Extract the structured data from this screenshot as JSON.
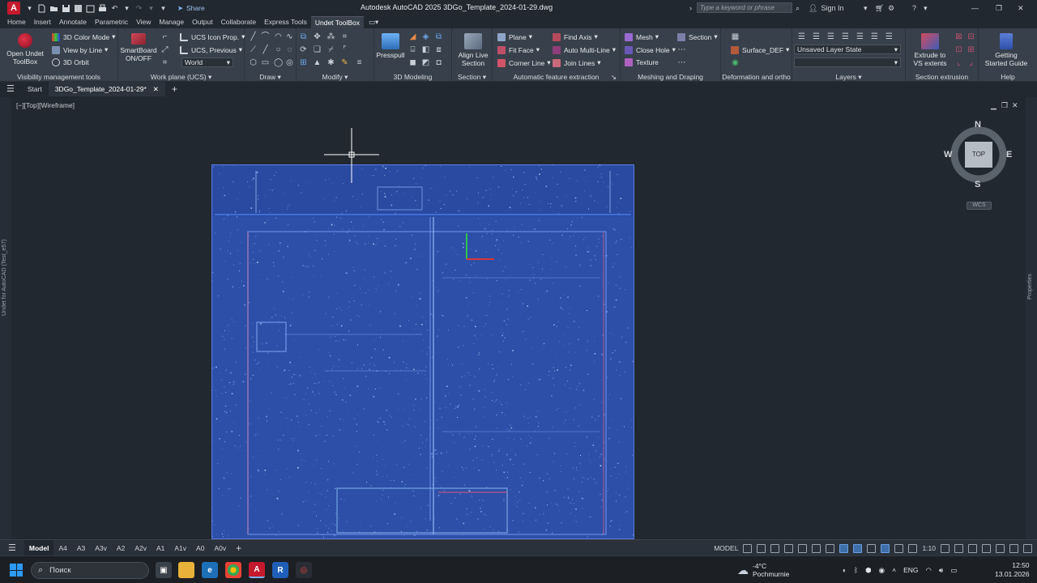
{
  "titlebar": {
    "app_letter": "A",
    "share_label": "Share",
    "title": "Autodesk AutoCAD 2025   3DGo_Template_2024-01-29.dwg",
    "search_placeholder": "Type a keyword or phrase",
    "sign_in": "Sign In"
  },
  "ribbon_tabs": [
    "Home",
    "Insert",
    "Annotate",
    "Parametric",
    "View",
    "Manage",
    "Output",
    "Collaborate",
    "Express Tools",
    "Undet ToolBox"
  ],
  "ribbon": {
    "open_undet": "Open Undet\nToolBox",
    "color_mode": "3D Color Mode",
    "view_by_line": "View by Line",
    "orbit": "3D Orbit",
    "visibility_title": "Visibility management tools",
    "smartboard": "SmartBoard\nON/OFF",
    "ucs_icon": "UCS Icon Prop.",
    "ucs_previous": "UCS, Previous",
    "ucs_world": "World",
    "workplane_title": "Work plane (UCS)",
    "draw_title": "Draw",
    "modify_title": "Modify",
    "presspull": "Presspull",
    "modeling_title": "3D Modeling",
    "align_live": "Align Live\nSection",
    "section_title": "Section",
    "plane": "Plane",
    "fit_face": "Fit Face",
    "corner_line": "Corner Line",
    "find_axis": "Find Axis",
    "auto_multiline": "Auto Multi-Line",
    "join_lines": "Join Lines",
    "auto_title": "Automatic feature extraction",
    "mesh": "Mesh",
    "close_hole": "Close Hole",
    "texture": "Texture",
    "section": "Section",
    "meshing_title": "Meshing and Draping",
    "surface_def": "Surface_DEF",
    "deform_title": "Deformation and ortho",
    "layer_state": "Unsaved Layer State",
    "layers_title": "Layers",
    "extrude": "Extrude to\nVS extents",
    "extrusion_title": "Section extrusion",
    "getting_started": "Getting\nStarted Guide",
    "help_title": "Help"
  },
  "doc_tabs": {
    "start": "Start",
    "active": "3DGo_Template_2024-01-29*"
  },
  "viewport": {
    "label": "[−][Top][Wireframe]",
    "compass": {
      "n": "N",
      "s": "S",
      "e": "E",
      "w": "W",
      "top": "TOP"
    },
    "wcs": "WCS",
    "left_palette": "Undet for AutoCAD (Test_e57)",
    "right_palette": "Properties"
  },
  "layout_tabs": [
    "Model",
    "A4",
    "A3",
    "A3v",
    "A2",
    "A2v",
    "A1",
    "A1v",
    "A0",
    "A0v"
  ],
  "status": {
    "mode": "MODEL",
    "scale": "1:10"
  },
  "taskbar": {
    "search": "Поиск",
    "weather_temp": "-4°C",
    "weather_desc": "Pochmurnie",
    "lang": "ENG",
    "time": "12:50",
    "date": "13.01.2026"
  },
  "colors": {
    "accent": "#3f7fd4",
    "cloud_fill": "#2d4fa8",
    "cloud_edge": "#5a7be0",
    "autocad_red": "#c5192d"
  }
}
